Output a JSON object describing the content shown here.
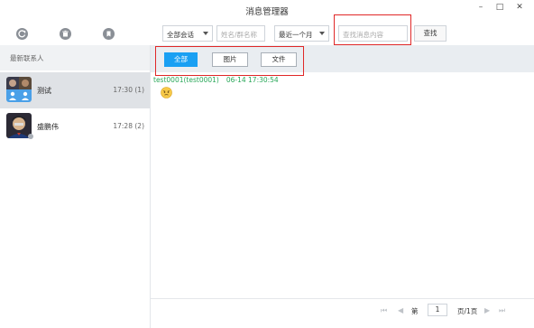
{
  "window": {
    "title": "消息管理器",
    "min_glyph": "–",
    "max_glyph": "□",
    "close_glyph": "✕"
  },
  "toolbar": {
    "icons": [
      "refresh-icon",
      "trash-icon",
      "export-icon"
    ],
    "conversation_filter": "全部会话",
    "name_placeholder": "姓名/群名称",
    "date_filter": "最近一个月",
    "search_placeholder": "查找消息内容",
    "search_button": "查找"
  },
  "sidebar": {
    "header": "最新联系人",
    "contacts": [
      {
        "name": "测试",
        "time": "17:30",
        "count": "(1)"
      },
      {
        "name": "盛鹏伟",
        "time": "17:28",
        "count": "(2)"
      }
    ]
  },
  "filter_tabs": {
    "all": "全部",
    "images": "图片",
    "files": "文件"
  },
  "messages": [
    {
      "sender": "test0001(test0001)",
      "time": "06-14 17:30:54",
      "content_icon": "emoji-icon"
    }
  ],
  "pager": {
    "page_label": "第",
    "page_value": "1",
    "page_total": "页/1页",
    "first_glyph": "⏮",
    "prev_glyph": "◀",
    "next_glyph": "▶",
    "last_glyph": "⏭"
  },
  "colors": {
    "accent": "#1aa0f3",
    "highlight_box": "#e02828",
    "message_header": "#2aa85a"
  }
}
